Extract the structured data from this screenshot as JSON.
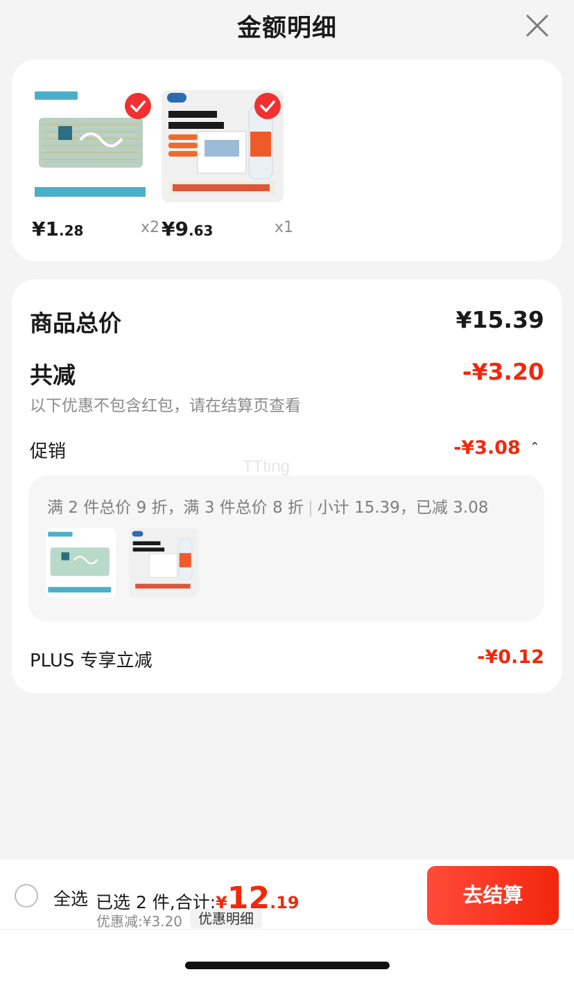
{
  "header": {
    "title": "金额明细",
    "close_icon": "close-icon"
  },
  "products": [
    {
      "name_icon": "toothpick-product-image",
      "price_int": "1",
      "price_dec": ".28",
      "currency": "¥",
      "qty": "x2"
    },
    {
      "name_icon": "water-product-image",
      "price_int": "9",
      "price_dec": ".63",
      "currency": "¥",
      "qty": "x1"
    }
  ],
  "summary": {
    "total_label": "商品总价",
    "total_value": "¥15.39",
    "reduce_label": "共减",
    "reduce_value": "-¥3.20",
    "note": "以下优惠不包含红包，请在结算页查看",
    "promo_label": "促销",
    "promo_value": "-¥3.08",
    "promo_desc": "满 2 件总价 9 折，满 3 件总价 8 折",
    "promo_subtotal": "小计 15.39，已减 3.08",
    "plus_label": "PLUS 专享立减",
    "plus_value": "-¥0.12"
  },
  "watermark": "TTting",
  "bottom": {
    "select_all": "全选",
    "selected_text": "已选 2 件,合计:",
    "total_currency": "¥",
    "total_int": "12",
    "total_dec": ".19",
    "discount_text": "优惠减:¥3.20",
    "detail_chip": "优惠明细",
    "checkout": "去结算"
  },
  "colors": {
    "accent_red": "#f2270c",
    "background": "#f4f4f4"
  }
}
